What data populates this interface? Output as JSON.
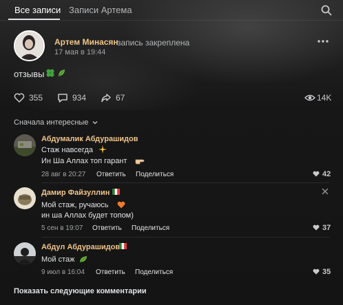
{
  "tabs": {
    "active": "Все записи",
    "inactive": "Записи Артема"
  },
  "post": {
    "author": "Артем Минасян",
    "action": "запись закреплена",
    "date": "17 мая в 19:44",
    "text": "отзывы",
    "likes": "355",
    "comments": "934",
    "shares": "67",
    "views": "14K"
  },
  "comments_section": {
    "sort_label": "Сначала интересные",
    "show_more": "Показать следующие комментарии",
    "reply_label": "Ответить",
    "share_label": "Поделиться",
    "items": [
      {
        "author": "Абдумалик Абдурашидов",
        "line1": "Стаж навсегда",
        "line2": "Ин Ша Аллах топ гарант",
        "date": "28 авг в 20:27",
        "likes": "42"
      },
      {
        "author": "Дамир Файзуллин",
        "line1": "Мой стаж, ручаюсь",
        "line2": "ин ша Аллах будет топом)",
        "date": "5 сен в 19:07",
        "likes": "37"
      },
      {
        "author": "Абдул Абдурашидов",
        "line1": "Мой стаж",
        "date": "9 июл в 16:04",
        "likes": "35"
      }
    ]
  },
  "icons": {
    "search": "search-icon",
    "more": "more-icon",
    "like": "heart-icon",
    "comment": "comment-icon",
    "share": "share-icon",
    "views": "eye-icon"
  },
  "colors": {
    "accent_name": "#f0c58a",
    "background": "#141414",
    "text": "#e1e3e6",
    "secondary": "#a0a3a7"
  }
}
